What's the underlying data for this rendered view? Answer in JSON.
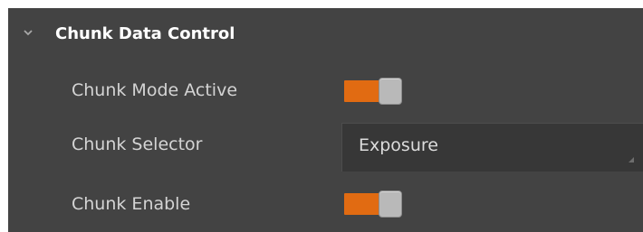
{
  "section": {
    "title": "Chunk Data Control",
    "expanded": true,
    "icon": "chevron-down-icon"
  },
  "rows": {
    "chunk_mode_active": {
      "label": "Chunk Mode Active",
      "value": true
    },
    "chunk_selector": {
      "label": "Chunk Selector",
      "value": "Exposure"
    },
    "chunk_enable": {
      "label": "Chunk Enable",
      "value": true
    }
  },
  "colors": {
    "panel_bg": "#434343",
    "toggle_on": "#e16b12",
    "knob": "#b9b9b9",
    "select_bg": "#373737",
    "label_text": "#d4d4d4",
    "title_text": "#ffffff"
  }
}
